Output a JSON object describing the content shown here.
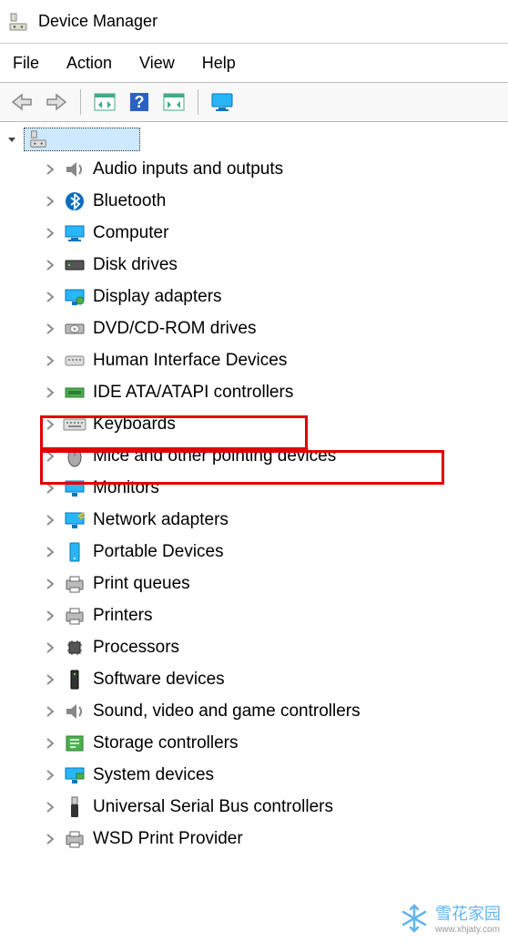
{
  "title": "Device Manager",
  "menu": {
    "file": "File",
    "action": "Action",
    "view": "View",
    "help": "Help"
  },
  "root": {
    "label": ""
  },
  "nodes": [
    {
      "icon": "audio",
      "label": "Audio inputs and outputs"
    },
    {
      "icon": "bluetooth",
      "label": "Bluetooth"
    },
    {
      "icon": "computer",
      "label": "Computer"
    },
    {
      "icon": "disk",
      "label": "Disk drives"
    },
    {
      "icon": "display",
      "label": "Display adapters"
    },
    {
      "icon": "dvd",
      "label": "DVD/CD-ROM drives"
    },
    {
      "icon": "hid",
      "label": "Human Interface Devices"
    },
    {
      "icon": "ide",
      "label": "IDE ATA/ATAPI controllers"
    },
    {
      "icon": "keyboard",
      "label": "Keyboards",
      "highlight": true
    },
    {
      "icon": "mouse",
      "label": "Mice and other pointing devices",
      "highlight": true
    },
    {
      "icon": "monitor",
      "label": "Monitors"
    },
    {
      "icon": "network",
      "label": "Network adapters"
    },
    {
      "icon": "portable",
      "label": "Portable Devices"
    },
    {
      "icon": "printq",
      "label": "Print queues"
    },
    {
      "icon": "printer",
      "label": "Printers"
    },
    {
      "icon": "cpu",
      "label": "Processors"
    },
    {
      "icon": "software",
      "label": "Software devices"
    },
    {
      "icon": "sound",
      "label": "Sound, video and game controllers"
    },
    {
      "icon": "storage",
      "label": "Storage controllers"
    },
    {
      "icon": "system",
      "label": "System devices"
    },
    {
      "icon": "usb",
      "label": "Universal Serial Bus controllers"
    },
    {
      "icon": "wsd",
      "label": "WSD Print Provider"
    }
  ],
  "watermark": {
    "text": "雪花家园",
    "url": "www.xhjaty.com"
  }
}
